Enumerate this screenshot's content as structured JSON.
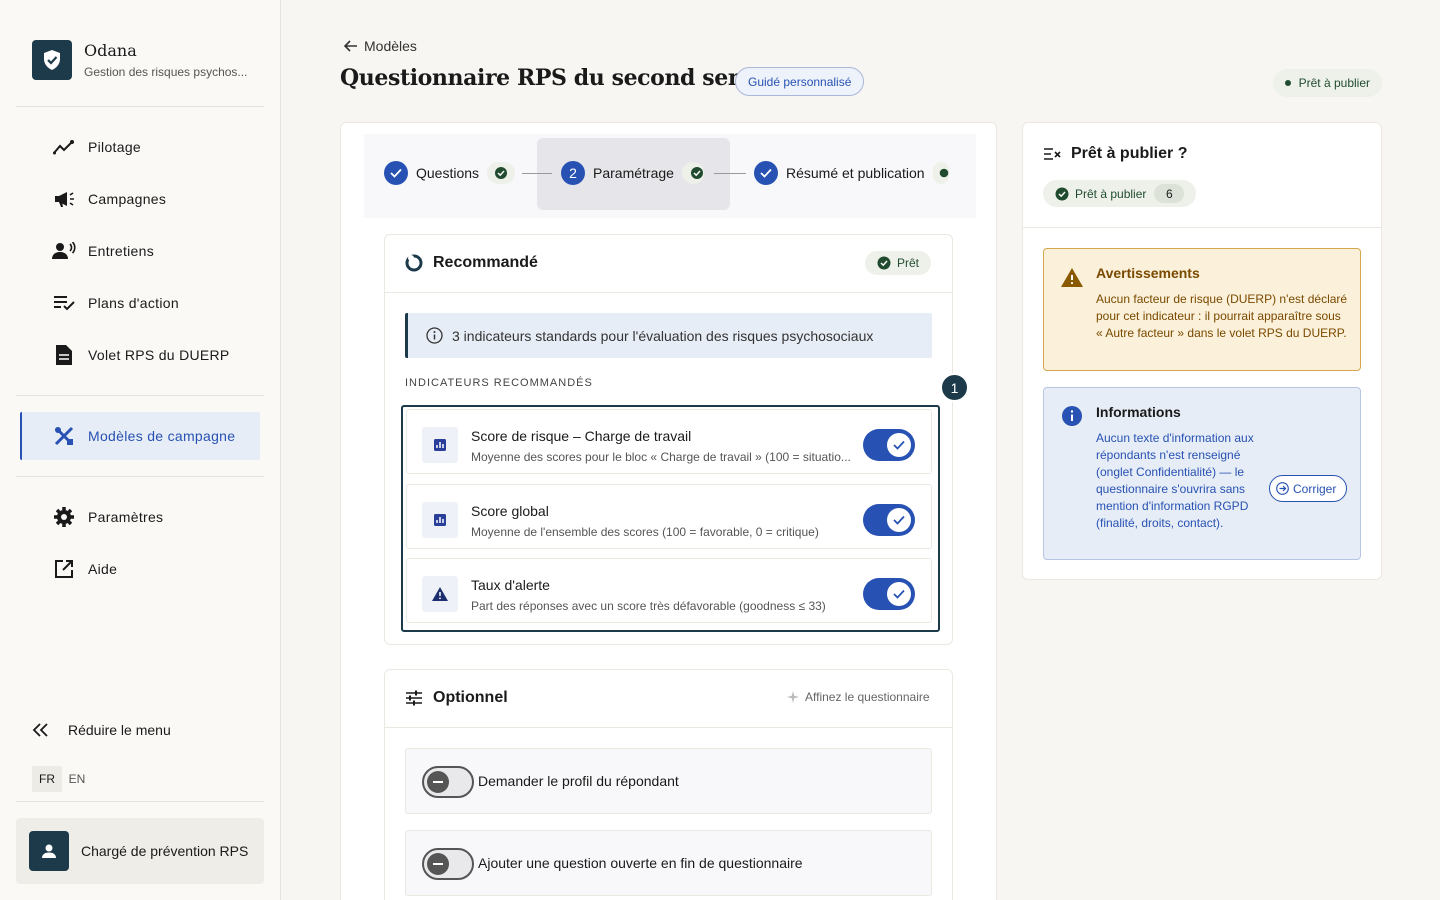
{
  "brand": {
    "name": "Odana",
    "subtitle": "Gestion des risques psychos..."
  },
  "sidebar": {
    "items": [
      {
        "label": "Pilotage",
        "icon": "trend-icon"
      },
      {
        "label": "Campagnes",
        "icon": "megaphone-icon"
      },
      {
        "label": "Entretiens",
        "icon": "person-voice-icon"
      },
      {
        "label": "Plans d'action",
        "icon": "checklist-icon"
      },
      {
        "label": "Volet RPS du DUERP",
        "icon": "document-icon"
      },
      {
        "label": "Modèles de campagne",
        "icon": "tools-icon",
        "active": true
      },
      {
        "label": "Paramètres",
        "icon": "gear-icon"
      },
      {
        "label": "Aide",
        "icon": "external-link-icon"
      }
    ],
    "collapse_label": "Réduire le menu",
    "lang": {
      "fr": "FR",
      "en": "EN",
      "active": "FR"
    },
    "user": {
      "name": "Chargé de prévention RPS"
    }
  },
  "header": {
    "back_label": "Modèles",
    "title": "Questionnaire RPS du second semestre",
    "guide_badge": "Guidé personnalisé",
    "status": "Prêt à publier"
  },
  "stepper": {
    "steps": [
      {
        "label": "Questions",
        "marker": "",
        "done": true
      },
      {
        "label": "Paramétrage",
        "marker": "2",
        "active": true
      },
      {
        "label": "Résumé et publication",
        "marker": "",
        "done": true
      }
    ]
  },
  "recommended": {
    "title": "Recommandé",
    "badge": "Prêt",
    "info": "3 indicateurs standards pour l'évaluation des risques psychosociaux",
    "section_label": "INDICATEURS RECOMMANDÉS",
    "step_number": "1",
    "indicators": [
      {
        "title": "Score de risque – Charge de travail",
        "desc": "Moyenne des scores pour le bloc « Charge de travail » (100 = situatio...",
        "icon": "chart-icon",
        "enabled": true
      },
      {
        "title": "Score global",
        "desc": "Moyenne de l'ensemble des scores (100 = favorable, 0 = critique)",
        "icon": "chart-icon",
        "enabled": true
      },
      {
        "title": "Taux d'alerte",
        "desc": "Part des réponses avec un score très défavorable (goodness ≤ 33)",
        "icon": "warning-icon",
        "enabled": true
      }
    ]
  },
  "optional": {
    "title": "Optionnel",
    "hint": "Affinez le questionnaire",
    "options": [
      {
        "label": "Demander le profil du répondant",
        "enabled": false
      },
      {
        "label": "Ajouter une question ouverte en fin de questionnaire",
        "enabled": false
      }
    ]
  },
  "publish_panel": {
    "title": "Prêt à publier ?",
    "badge": "Prêt à publier",
    "count": "6",
    "warning": {
      "title": "Avertissements",
      "text": "Aucun facteur de risque (DUERP) n'est déclaré pour cet indicateur : il pourrait apparaître sous « Autre facteur » dans le volet RPS du DUERP."
    },
    "info": {
      "title": "Informations",
      "text": "Aucun texte d'information aux répondants n'est renseigné (onglet Confidentialité) — le questionnaire s'ouvrira sans mention d'information RGPD (finalité, droits, contact).",
      "fix_label": "Corriger"
    }
  },
  "colors": {
    "primary": "#2752b3",
    "dark": "#1d3a4a",
    "success": "#214b2f",
    "warning": "#7a4a00"
  }
}
